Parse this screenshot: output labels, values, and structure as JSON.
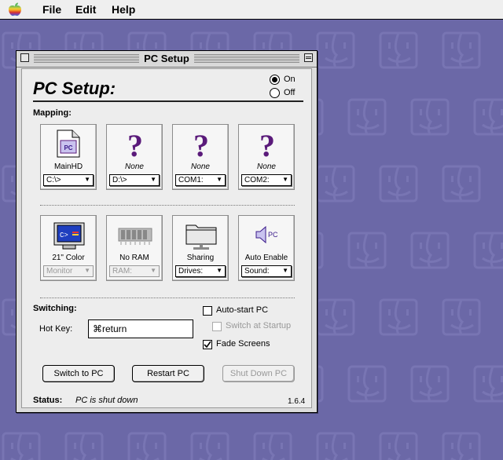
{
  "menubar": {
    "items": [
      "File",
      "Edit",
      "Help"
    ]
  },
  "window": {
    "title": "PC Setup"
  },
  "panel": {
    "title": "PC Setup:",
    "power": {
      "on_label": "On",
      "off_label": "Off",
      "selected": "on"
    }
  },
  "mapping": {
    "label": "Mapping:",
    "drives": [
      {
        "icon": "pc-disk-icon",
        "label": "MainHD",
        "italic": false,
        "popup": "C:\\>"
      },
      {
        "icon": "question-mark-icon",
        "label": "None",
        "italic": true,
        "popup": "D:\\>"
      },
      {
        "icon": "question-mark-icon",
        "label": "None",
        "italic": true,
        "popup": "COM1:"
      },
      {
        "icon": "question-mark-icon",
        "label": "None",
        "italic": true,
        "popup": "COM2:"
      }
    ],
    "devices": [
      {
        "icon": "monitor-icon",
        "label": "21\" Color",
        "popup": "Monitor",
        "enabled": false
      },
      {
        "icon": "ram-chip-icon",
        "label": "No RAM",
        "popup": "RAM:",
        "enabled": false
      },
      {
        "icon": "shared-folder-icon",
        "label": "Sharing",
        "popup": "Drives:",
        "enabled": true
      },
      {
        "icon": "pc-speaker-icon",
        "label": "Auto Enable",
        "popup": "Sound:",
        "enabled": true
      }
    ]
  },
  "switching": {
    "label": "Switching:",
    "hotkey_label": "Hot Key:",
    "hotkey_value": "⌘return",
    "autostart_label": "Auto-start PC",
    "switch_startup_label": "Switch at Startup",
    "fade_label": "Fade Screens",
    "autostart_checked": false,
    "switch_startup_checked": false,
    "fade_checked": true
  },
  "buttons": {
    "switch": "Switch to PC",
    "restart": "Restart PC",
    "shutdown": "Shut Down PC"
  },
  "status": {
    "label": "Status:",
    "value": "PC is shut down",
    "version": "1.6.4"
  },
  "colors": {
    "desktop": "#6b68a7",
    "accent": "#5a1a7a"
  }
}
